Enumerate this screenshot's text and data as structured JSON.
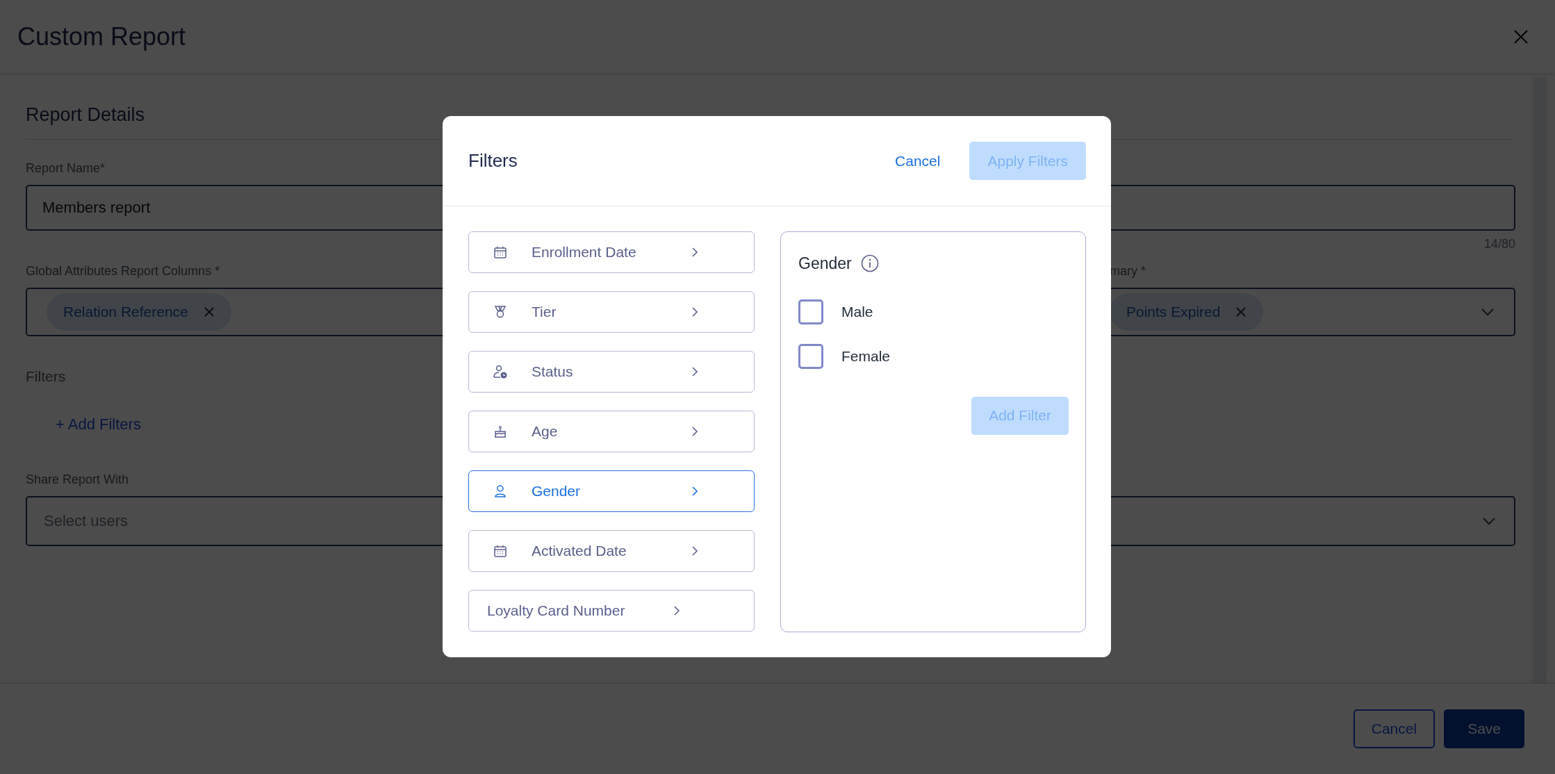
{
  "window": {
    "title": "Custom Report"
  },
  "report_details": {
    "heading": "Report Details",
    "report_name": {
      "label": "Report Name*",
      "value": "Members report",
      "counter": "14/80"
    },
    "global_columns": {
      "label": "Global Attributes Report Columns *",
      "chips": [
        "Relation Reference"
      ]
    },
    "summary_columns": {
      "label": "mary *",
      "chips": [
        "Points Expired"
      ]
    },
    "filters": {
      "label": "Filters",
      "add_link": "+ Add Filters"
    },
    "share": {
      "label": "Share Report With",
      "placeholder": "Select users"
    }
  },
  "footer": {
    "buttons": [
      {
        "label": "Cancel",
        "kind": "outline"
      },
      {
        "label": "Save",
        "kind": "primary"
      }
    ]
  },
  "filters_dialog": {
    "title": "Filters",
    "cancel": "Cancel",
    "apply": {
      "label": "Apply Filters",
      "disabled": true
    },
    "items": [
      {
        "label": "Enrollment Date",
        "selected": false
      },
      {
        "label": "Tier",
        "selected": false
      },
      {
        "label": "Status",
        "selected": false
      },
      {
        "label": "Age",
        "selected": false
      },
      {
        "label": "Gender",
        "selected": true
      },
      {
        "label": "Activated Date",
        "selected": false
      },
      {
        "label": "Loyalty Card Number",
        "selected": false
      }
    ],
    "panel": {
      "title": "Gender",
      "options": [
        {
          "label": "Male",
          "checked": false
        },
        {
          "label": "Female",
          "checked": false
        }
      ],
      "add": {
        "label": "Add Filter",
        "disabled": true
      }
    }
  }
}
